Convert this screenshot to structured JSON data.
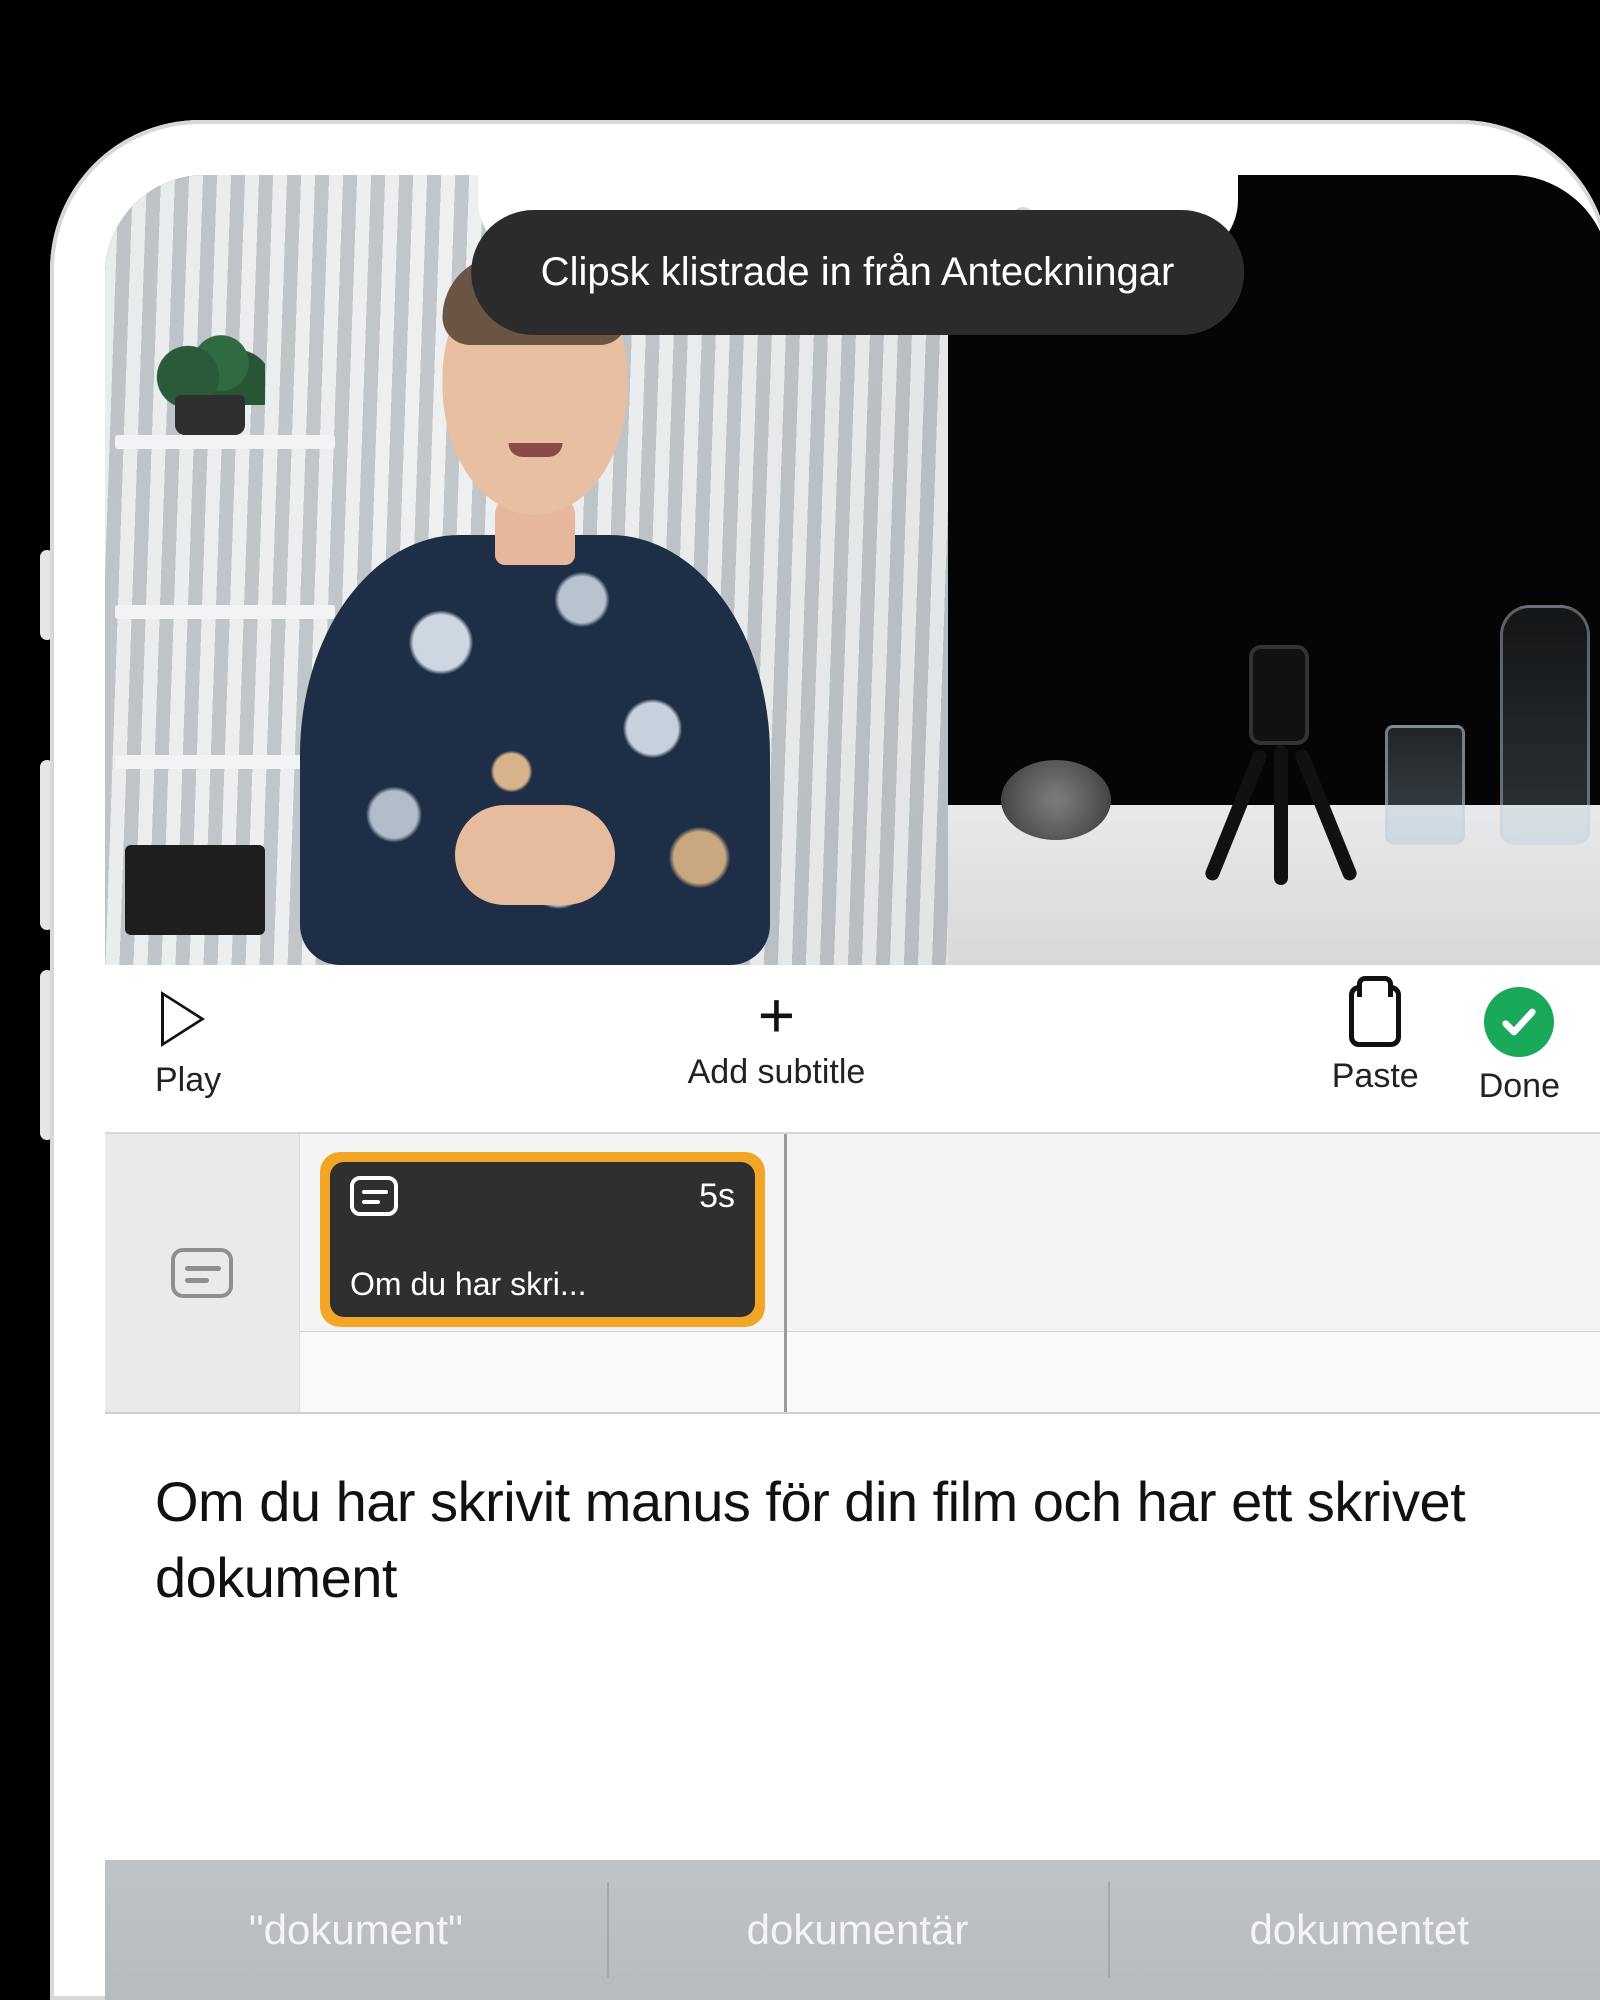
{
  "toast": {
    "message": "Clipsk klistrade in från Anteckningar"
  },
  "toolbar": {
    "play_label": "Play",
    "add_label": "Add subtitle",
    "paste_label": "Paste",
    "done_label": "Done"
  },
  "timeline": {
    "clip": {
      "duration": "5s",
      "preview": "Om du har skri..."
    }
  },
  "editor": {
    "text": "Om du har skrivit manus för din film och har ett skrivet dokument"
  },
  "keyboard": {
    "suggestions": [
      "\"dokument\"",
      "dokumentär",
      "dokumentet"
    ]
  }
}
